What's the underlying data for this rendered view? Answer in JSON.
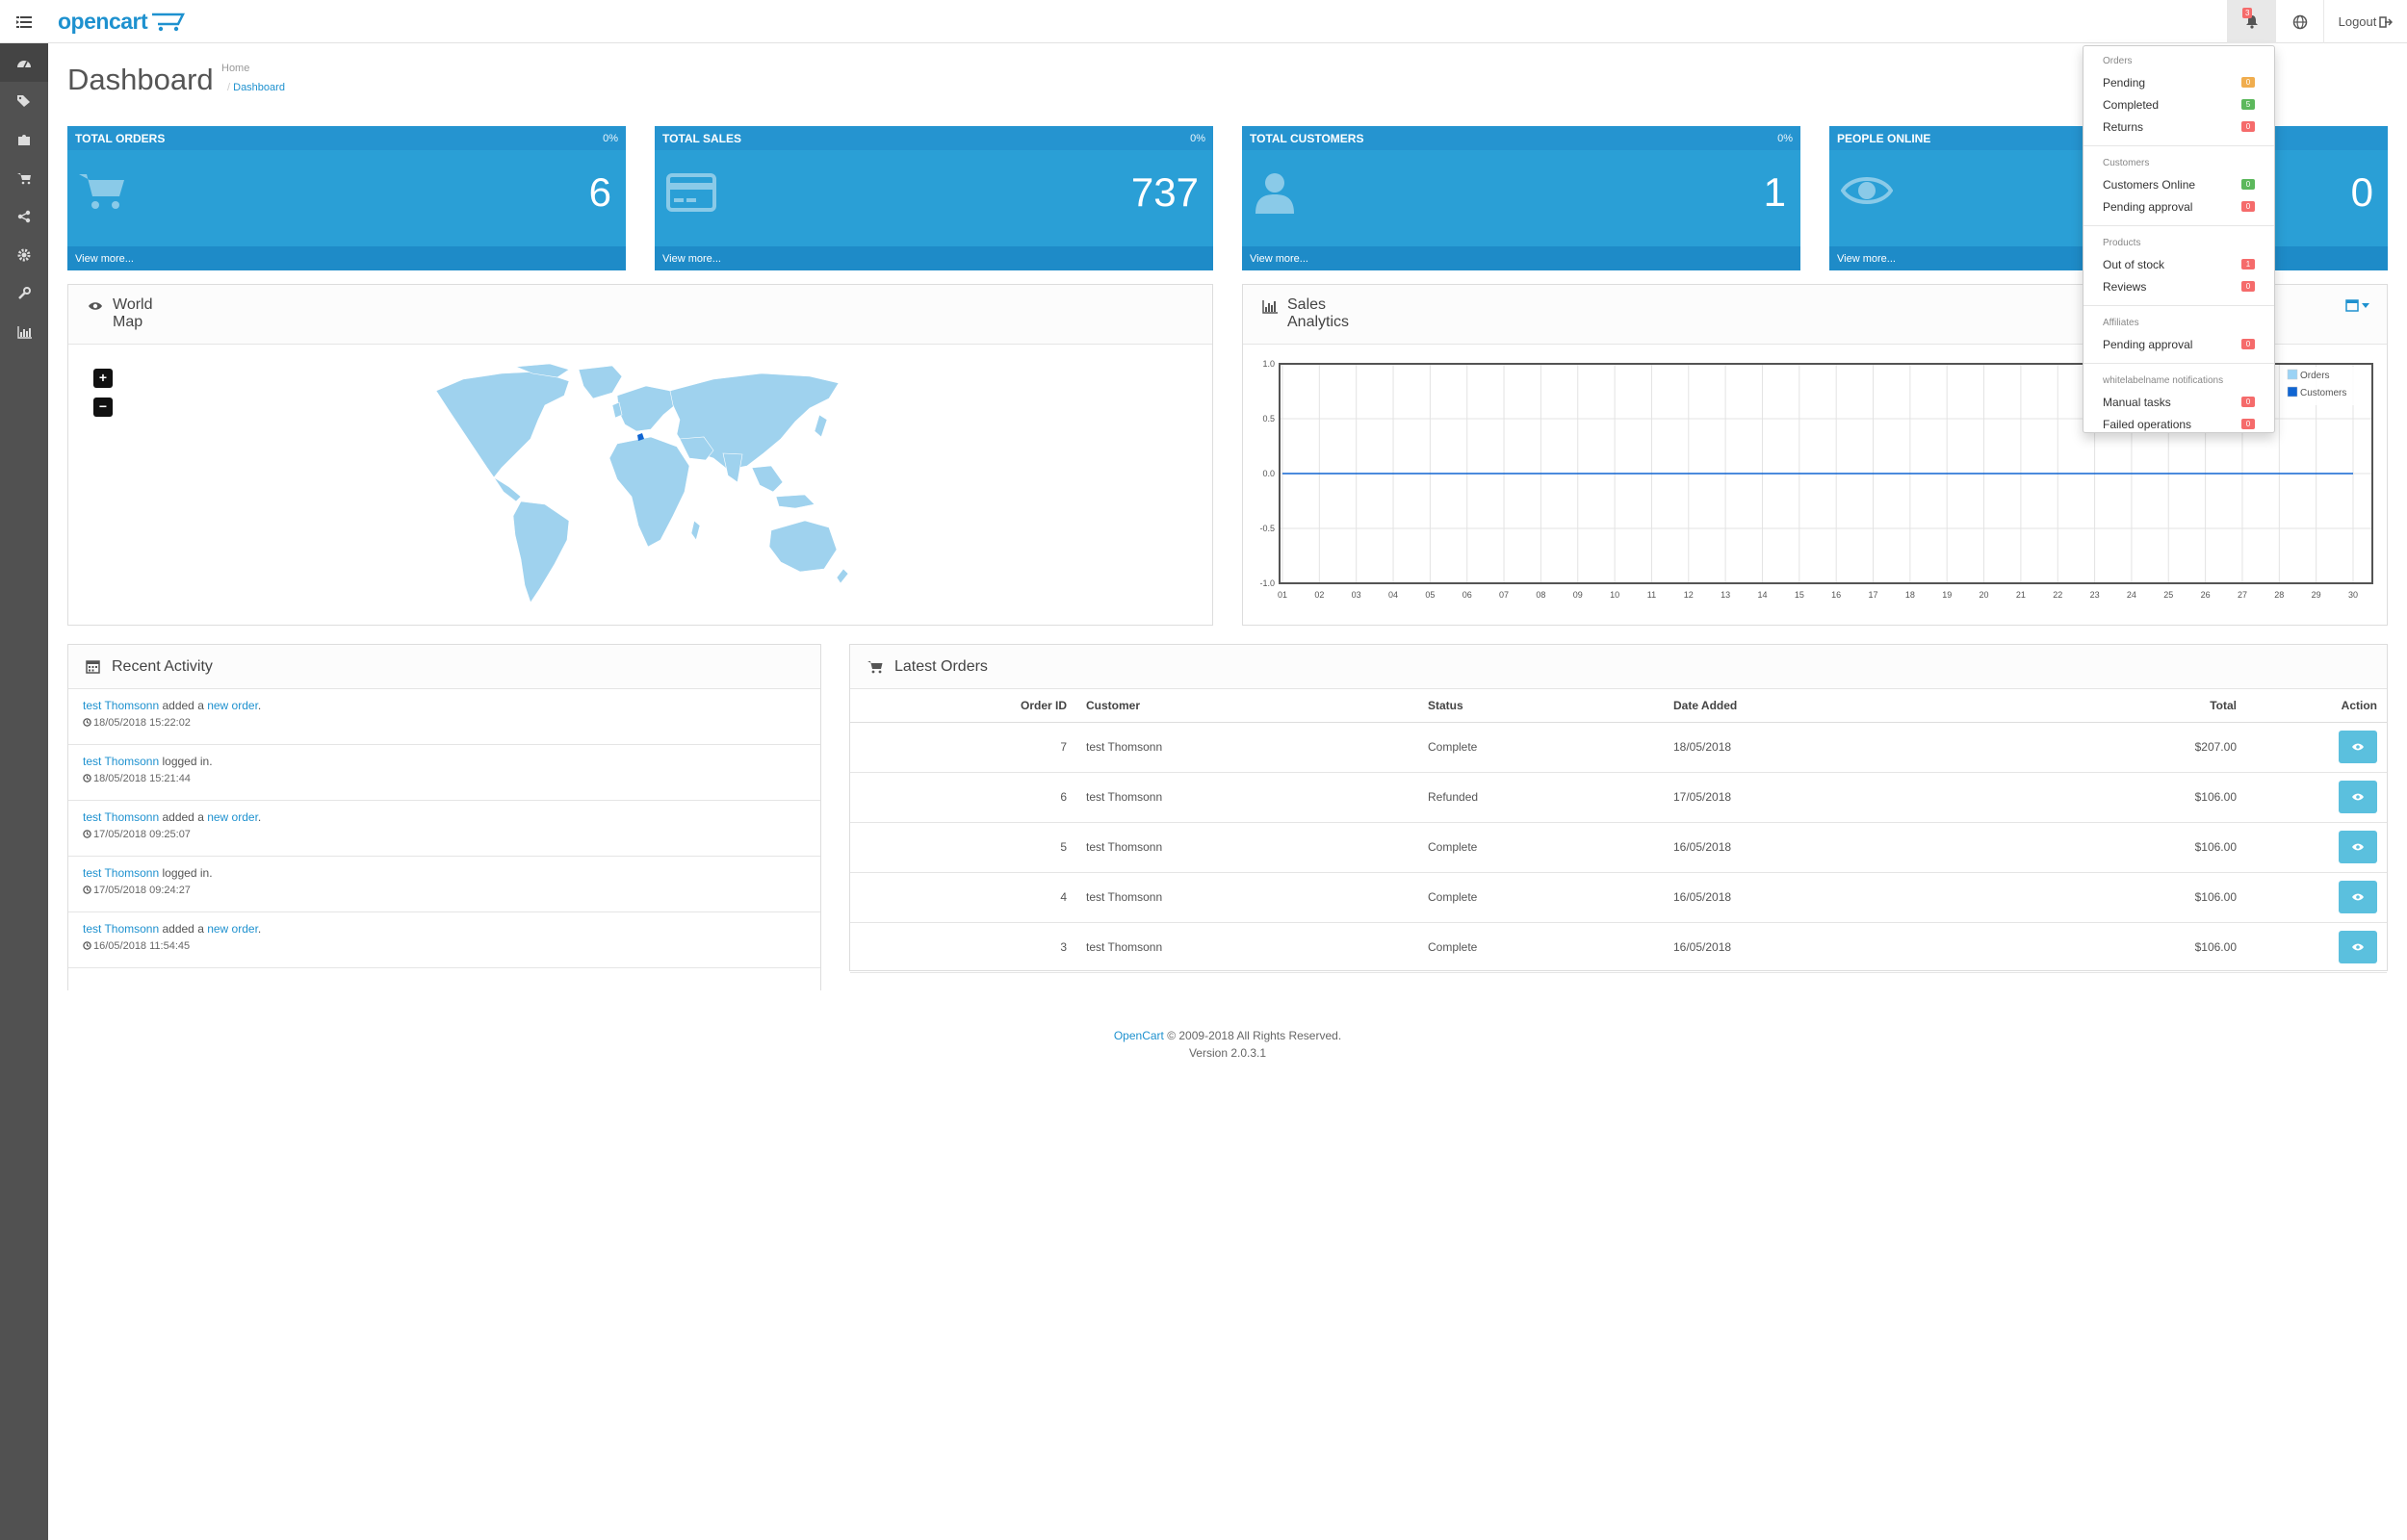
{
  "header": {
    "logo_text": "opencart",
    "bell_badge": "3",
    "logout_label": "Logout"
  },
  "sidebar": {
    "items": [
      {
        "icon": "dashboard-icon"
      },
      {
        "icon": "tags-icon"
      },
      {
        "icon": "puzzle-icon"
      },
      {
        "icon": "shopping-cart-icon"
      },
      {
        "icon": "share-icon"
      },
      {
        "icon": "cog-icon"
      },
      {
        "icon": "wrench-icon"
      },
      {
        "icon": "bar-chart-icon"
      }
    ]
  },
  "page": {
    "title": "Dashboard",
    "breadcrumb": [
      "Home",
      "Dashboard"
    ]
  },
  "tiles": [
    {
      "title": "TOTAL ORDERS",
      "pct": "0%",
      "value": "6",
      "link": "View more...",
      "icon": "shopping-cart-icon"
    },
    {
      "title": "TOTAL SALES",
      "pct": "0%",
      "value": "737",
      "link": "View more...",
      "icon": "credit-card-icon"
    },
    {
      "title": "TOTAL CUSTOMERS",
      "pct": "0%",
      "value": "1",
      "link": "View more...",
      "icon": "user-icon"
    },
    {
      "title": "PEOPLE ONLINE",
      "pct": "",
      "value": "0",
      "link": "View more...",
      "icon": "eye-icon"
    }
  ],
  "map": {
    "title_line1": "World",
    "title_line2": "Map",
    "zoom_in": "+",
    "zoom_out": "−"
  },
  "analytics": {
    "title_line1": "Sales",
    "title_line2": "Analytics"
  },
  "chart_data": {
    "type": "line",
    "x": [
      "01",
      "02",
      "03",
      "04",
      "05",
      "06",
      "07",
      "08",
      "09",
      "10",
      "11",
      "12",
      "13",
      "14",
      "15",
      "16",
      "17",
      "18",
      "19",
      "20",
      "21",
      "22",
      "23",
      "24",
      "25",
      "26",
      "27",
      "28",
      "29",
      "30"
    ],
    "series": [
      {
        "name": "Orders",
        "values": [
          0,
          0,
          0,
          0,
          0,
          0,
          0,
          0,
          0,
          0,
          0,
          0,
          0,
          0,
          0,
          0,
          0,
          0,
          0,
          0,
          0,
          0,
          0,
          0,
          0,
          0,
          0,
          0,
          0,
          0
        ],
        "color": "#9bd3f5"
      },
      {
        "name": "Customers",
        "values": [
          0,
          0,
          0,
          0,
          0,
          0,
          0,
          0,
          0,
          0,
          0,
          0,
          0,
          0,
          0,
          0,
          0,
          0,
          0,
          0,
          0,
          0,
          0,
          0,
          0,
          0,
          0,
          0,
          0,
          0
        ],
        "color": "#1065d2"
      }
    ],
    "yticks": [
      "1.0",
      "0.5",
      "0.0",
      "-0.5",
      "-1.0"
    ],
    "ylim": [
      -1,
      1
    ],
    "grid": true,
    "legend": "top-right"
  },
  "activity": {
    "title": "Recent Activity",
    "items": [
      {
        "user": "test Thomsonn",
        "action": " added a ",
        "link": "new order",
        "end": ".",
        "time": "18/05/2018 15:22:02"
      },
      {
        "user": "test Thomsonn",
        "action": " logged in.",
        "link": "",
        "end": "",
        "time": "18/05/2018 15:21:44"
      },
      {
        "user": "test Thomsonn",
        "action": " added a ",
        "link": "new order",
        "end": ".",
        "time": "17/05/2018 09:25:07"
      },
      {
        "user": "test Thomsonn",
        "action": " logged in.",
        "link": "",
        "end": "",
        "time": "17/05/2018 09:24:27"
      },
      {
        "user": "test Thomsonn",
        "action": " added a ",
        "link": "new order",
        "end": ".",
        "time": "16/05/2018 11:54:45"
      }
    ]
  },
  "orders": {
    "title": "Latest Orders",
    "columns": [
      "Order ID",
      "Customer",
      "Status",
      "Date Added",
      "Total",
      "Action"
    ],
    "rows": [
      {
        "id": "7",
        "customer": "test Thomsonn",
        "status": "Complete",
        "date": "18/05/2018",
        "total": "$207.00"
      },
      {
        "id": "6",
        "customer": "test Thomsonn",
        "status": "Refunded",
        "date": "17/05/2018",
        "total": "$106.00"
      },
      {
        "id": "5",
        "customer": "test Thomsonn",
        "status": "Complete",
        "date": "16/05/2018",
        "total": "$106.00"
      },
      {
        "id": "4",
        "customer": "test Thomsonn",
        "status": "Complete",
        "date": "16/05/2018",
        "total": "$106.00"
      },
      {
        "id": "3",
        "customer": "test Thomsonn",
        "status": "Complete",
        "date": "16/05/2018",
        "total": "$106.00"
      }
    ]
  },
  "footer": {
    "link": "OpenCart",
    "copy": " © 2009-2018 All Rights Reserved.",
    "version": "Version 2.0.3.1"
  },
  "notifications": {
    "groups": [
      {
        "heading": "Orders",
        "items": [
          {
            "label": "Pending",
            "count": "0",
            "color": "#f0ad4e"
          },
          {
            "label": "Completed",
            "count": "5",
            "color": "#5cb85c"
          },
          {
            "label": "Returns",
            "count": "0",
            "color": "#f56b6b"
          }
        ]
      },
      {
        "heading": "Customers",
        "items": [
          {
            "label": "Customers Online",
            "count": "0",
            "color": "#5cb85c"
          },
          {
            "label": "Pending approval",
            "count": "0",
            "color": "#f56b6b"
          }
        ]
      },
      {
        "heading": "Products",
        "items": [
          {
            "label": "Out of stock",
            "count": "1",
            "color": "#f56b6b"
          },
          {
            "label": "Reviews",
            "count": "0",
            "color": "#f56b6b"
          }
        ]
      },
      {
        "heading": "Affiliates",
        "items": [
          {
            "label": "Pending approval",
            "count": "0",
            "color": "#f56b6b"
          }
        ]
      },
      {
        "heading": "whitelabelname notifications",
        "items": [
          {
            "label": "Manual tasks",
            "count": "0",
            "color": "#f56b6b"
          },
          {
            "label": "Failed operations",
            "count": "0",
            "color": "#f56b6b"
          }
        ]
      }
    ]
  }
}
